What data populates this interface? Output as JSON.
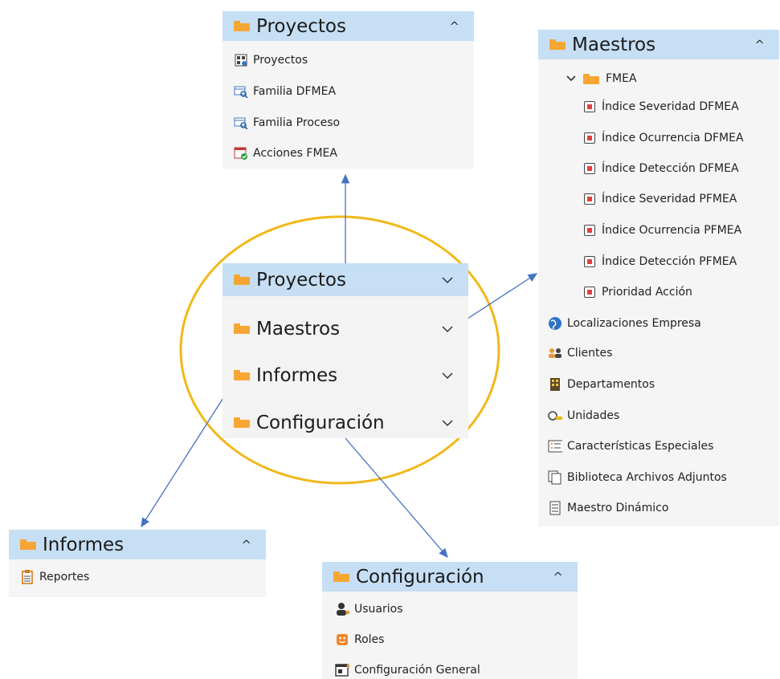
{
  "colors": {
    "header_bg": "#c6dff4",
    "panel_bg": "#f5f5f5",
    "folder": "#f7a634",
    "ellipse": "#f2b81a",
    "arrow": "#4472c4"
  },
  "proyectos_panel": {
    "title": "Proyectos",
    "chevron": "^",
    "items": [
      {
        "label": "Proyectos",
        "icon": "grid-gear-icon"
      },
      {
        "label": "Familia DFMEA",
        "icon": "table-search-icon"
      },
      {
        "label": "Familia Proceso",
        "icon": "table-search-icon"
      },
      {
        "label": "Acciones FMEA",
        "icon": "calendar-check-icon"
      }
    ]
  },
  "main_menu": {
    "rows": [
      {
        "label": "Proyectos",
        "chevron": "v"
      },
      {
        "label": "Maestros",
        "chevron": "v"
      },
      {
        "label": "Informes",
        "chevron": "v"
      },
      {
        "label": "Configuración",
        "chevron": "v"
      }
    ]
  },
  "maestros_panel": {
    "title": "Maestros",
    "chevron": "^",
    "group": {
      "label": "FMEA",
      "chevron": "v"
    },
    "sub_items": [
      {
        "label": "Índice Severidad DFMEA"
      },
      {
        "label": "Índice Ocurrencia DFMEA"
      },
      {
        "label": "Índice Detección DFMEA"
      },
      {
        "label": "Índice Severidad PFMEA"
      },
      {
        "label": "Índice Ocurrencia PFMEA"
      },
      {
        "label": "Índice Detección PFMEA"
      },
      {
        "label": "Prioridad Acción"
      }
    ],
    "items": [
      {
        "label": "Localizaciones Empresa",
        "icon": "globe-icon"
      },
      {
        "label": "Clientes",
        "icon": "users-icon"
      },
      {
        "label": "Departamentos",
        "icon": "building-icon"
      },
      {
        "label": "Unidades",
        "icon": "ruler-icon"
      },
      {
        "label": "Características Especiales",
        "icon": "list-icon"
      },
      {
        "label": "Biblioteca Archivos Adjuntos",
        "icon": "files-icon"
      },
      {
        "label": "Maestro Dinámico",
        "icon": "document-icon"
      }
    ]
  },
  "informes_panel": {
    "title": "Informes",
    "chevron": "^",
    "items": [
      {
        "label": "Reportes",
        "icon": "clipboard-icon"
      }
    ]
  },
  "configuracion_panel": {
    "title": "Configuración",
    "chevron": "^",
    "items": [
      {
        "label": "Usuarios",
        "icon": "user-key-icon"
      },
      {
        "label": "Roles",
        "icon": "mask-icon"
      },
      {
        "label": "Configuración General",
        "icon": "settings-window-icon"
      }
    ]
  }
}
